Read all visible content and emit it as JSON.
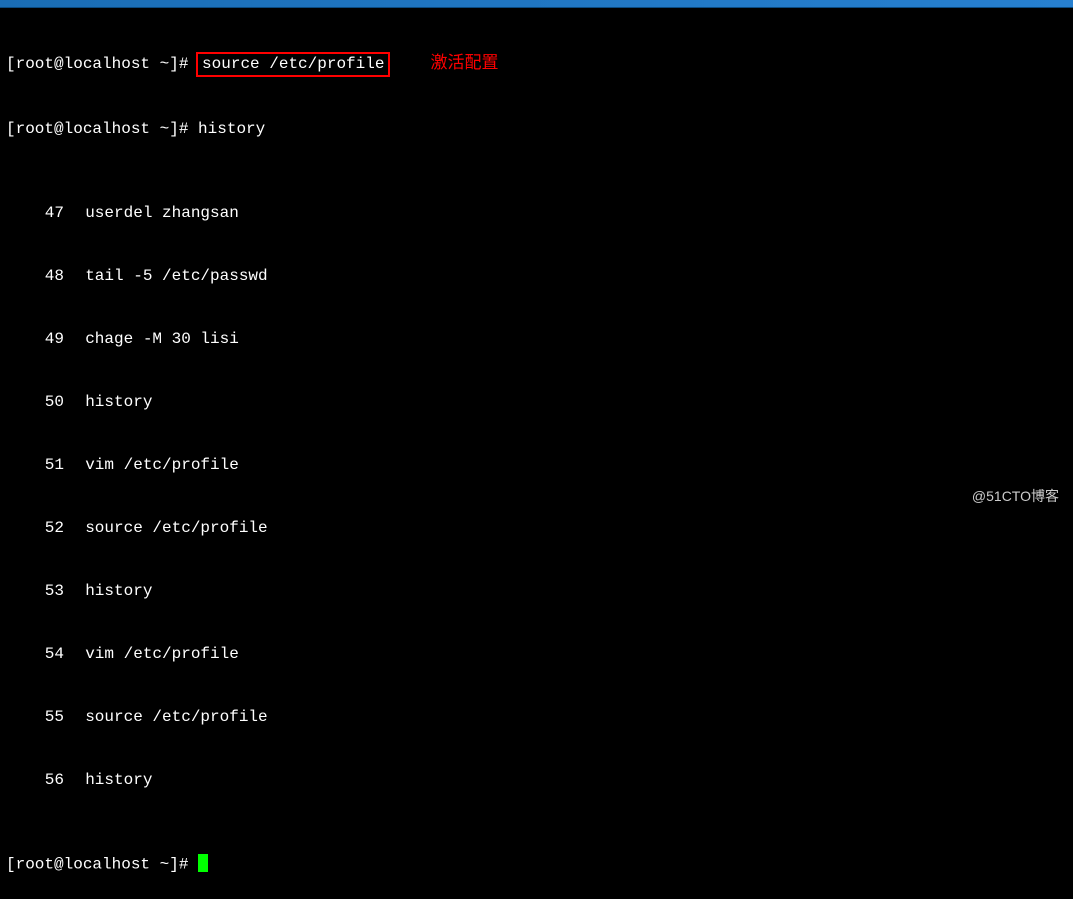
{
  "titlebar": {},
  "lines": {
    "prompt1": "[root@localhost ~]# ",
    "cmd1": "source /etc/profile",
    "annotation1": "激活配置",
    "prompt2": "[root@localhost ~]# ",
    "cmd2": "history",
    "history": [
      {
        "n": "47",
        "cmd": "userdel zhangsan"
      },
      {
        "n": "48",
        "cmd": "tail -5 /etc/passwd"
      },
      {
        "n": "49",
        "cmd": "chage -M 30 lisi"
      },
      {
        "n": "50",
        "cmd": "history"
      },
      {
        "n": "51",
        "cmd": "vim /etc/profile"
      },
      {
        "n": "52",
        "cmd": "source /etc/profile"
      },
      {
        "n": "53",
        "cmd": "history"
      },
      {
        "n": "54",
        "cmd": "vim /etc/profile"
      },
      {
        "n": "55",
        "cmd": "source /etc/profile"
      },
      {
        "n": "56",
        "cmd": "history"
      }
    ],
    "prompt3": "[root@localhost ~]# "
  },
  "watermark": "@51CTO博客"
}
